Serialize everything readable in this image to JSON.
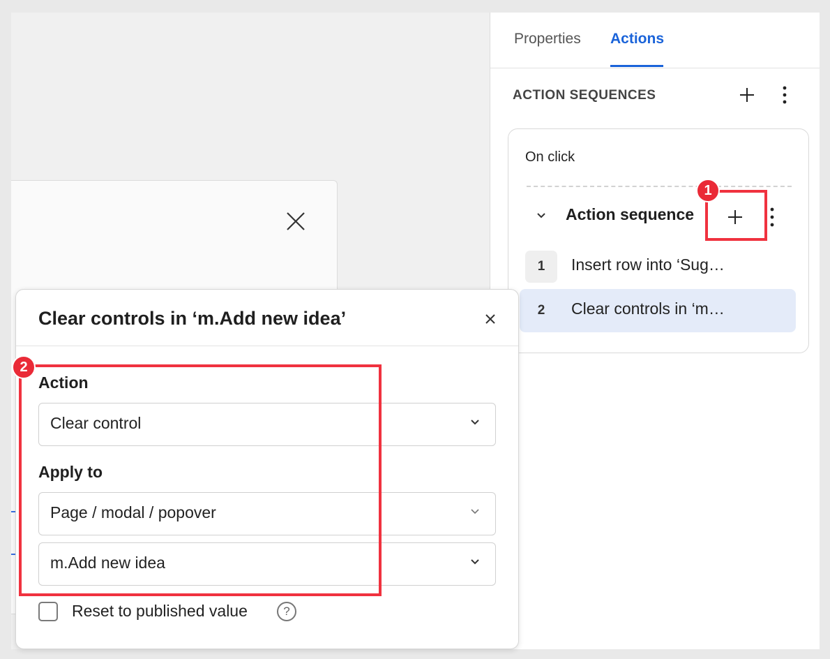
{
  "tabs": [
    {
      "label": "Properties"
    },
    {
      "label": "Actions"
    }
  ],
  "panel": {
    "header": "ACTION SEQUENCES",
    "trigger": "On click",
    "sequence_title": "Action sequence",
    "steps": [
      {
        "num": "1",
        "label": "Insert row into ‘Sug…"
      },
      {
        "num": "2",
        "label": "Clear controls in ‘m…"
      }
    ]
  },
  "popover": {
    "title": "Clear controls in ‘m.Add new idea’",
    "action_label": "Action",
    "action_value": "Clear control",
    "apply_label": "Apply to",
    "apply_scope": "Page / modal / popover",
    "apply_target": "m.Add new idea",
    "reset_label": "Reset to published value",
    "help_glyph": "?"
  },
  "annotations": {
    "badge_1": "1",
    "badge_2": "2"
  },
  "colors": {
    "accent": "#1a63d9",
    "annotation_red": "#f0323f",
    "selected_row": "#e4ebf9"
  }
}
